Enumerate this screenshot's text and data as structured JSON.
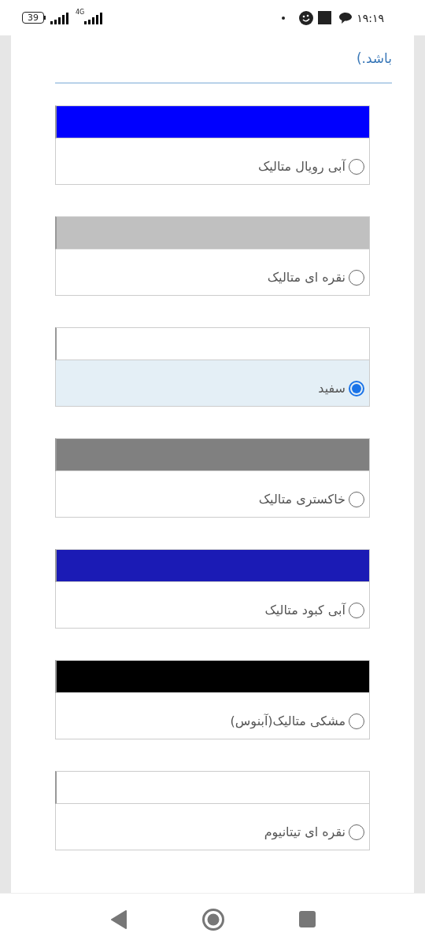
{
  "status_bar": {
    "battery": "39",
    "network": "4G",
    "time": "۱۹:۱۹"
  },
  "intro_tail": "باشد.)",
  "color_options": [
    {
      "label": "آبی رویال متالیک",
      "color": "#0000ff",
      "selected": false
    },
    {
      "label": "نقره ای متالیک",
      "color": "#c0c0c0",
      "selected": false
    },
    {
      "label": "سفید",
      "color": "#ffffff",
      "selected": true
    },
    {
      "label": "خاکستری متالیک",
      "color": "#808080",
      "selected": false
    },
    {
      "label": "آبی کبود متالیک",
      "color": "#1b1bb5",
      "selected": false
    },
    {
      "label": "مشکی متالیک(آبنوس)",
      "color": "#000000",
      "selected": false
    },
    {
      "label": "نقره ای تیتانیوم",
      "color": "#ffffff",
      "selected": false
    }
  ]
}
